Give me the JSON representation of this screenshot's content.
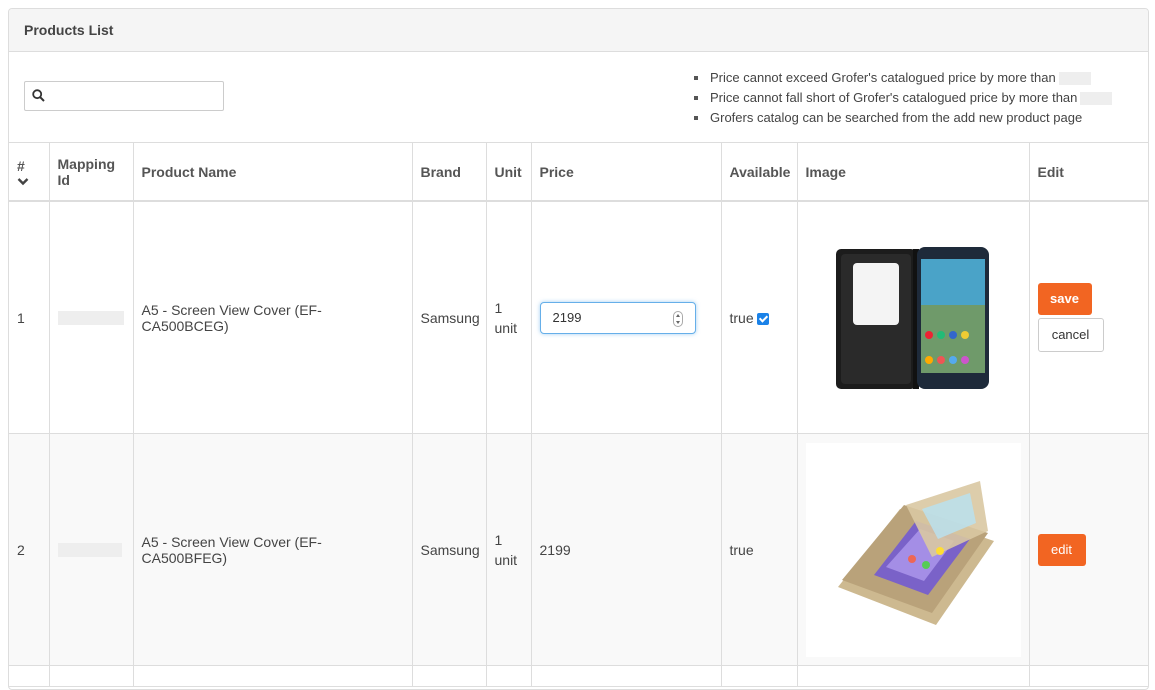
{
  "panel": {
    "title": "Products List"
  },
  "search": {
    "placeholder": "",
    "value": ""
  },
  "notes": [
    "Price cannot exceed Grofer's catalogued price by more than",
    "Price cannot fall short of Grofer's catalogued price by more than",
    "Grofers catalog can be searched from the add new product page"
  ],
  "table": {
    "headers": {
      "num": "#",
      "mapping_id": "Mapping Id",
      "product_name": "Product Name",
      "brand": "Brand",
      "unit": "Unit",
      "price": "Price",
      "available": "Available",
      "image": "Image",
      "edit": "Edit"
    },
    "rows": [
      {
        "num": "1",
        "product_name": "A5 - Screen View Cover (EF-CA500BCEG)",
        "brand": "Samsung",
        "unit": "1 unit",
        "price": "2199",
        "available": "true",
        "available_checked": true,
        "image": "black-flip-cover-phone",
        "save_label": "save",
        "cancel_label": "cancel"
      },
      {
        "num": "2",
        "product_name": "A5 - Screen View Cover (EF-CA500BFEG)",
        "brand": "Samsung",
        "unit": "1 unit",
        "price": "2199",
        "available": "true",
        "image": "gold-flip-cover-phone",
        "edit_label": "edit"
      }
    ]
  },
  "colors": {
    "accent": "#f26522",
    "checkbox": "#1a82e8",
    "focus": "#66afe9"
  }
}
